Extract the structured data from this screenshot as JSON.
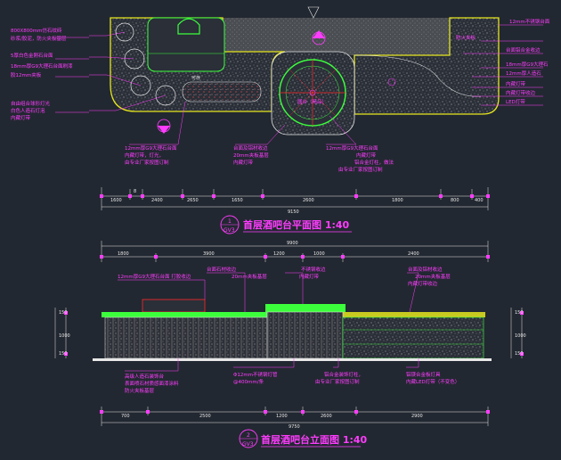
{
  "plan": {
    "title": "首层酒吧台平面图 1:40",
    "mark_num": "1",
    "mark_sheet": "GV3",
    "dims_top": [
      "1600",
      "8",
      "2400",
      "2650",
      "1650",
      "2600",
      "1800",
      "800",
      "400"
    ],
    "dim_total": "9150",
    "labels": {
      "ul1": "800X800mm仿石纹砖",
      "ul2": "砂浆/胶泥，防火夹板基层",
      "ul3": "5厚白色金刚石台面",
      "ul4": "18mm厚G9大理石台面刷漆",
      "ul5": "胶12mm夹板",
      "ul6": "自由组合球形灯光",
      "ul7": "白色人造石灯泡",
      "ul8": "内藏灯带",
      "counter": "可存",
      "center_title": "圆台（精品）",
      "bl1": "12mm厚G9大理石台面",
      "bl2": "内藏灯带，灯光，",
      "bl3": "由专业厂家按图订制",
      "bm1": "台面及铝材收边",
      "bm2": "20mm夹板基层",
      "bm3": "内藏灯带",
      "bc1": "12mm厚G9大理石台面",
      "bc2": "内藏灯带",
      "bc3": "铝合金灯柱，做法",
      "bc4": "由专业厂家按图订制",
      "r1": "12mm不锈钢台面",
      "r2": "防火夹板",
      "r3": "台面铝合金收边",
      "r4": "18mm厚G9大理石",
      "r5": "12mm厚人造石",
      "r6": "内藏灯带",
      "r7": "内藏灯带收边",
      "r8": "LED灯带"
    }
  },
  "elevation": {
    "title": "首层酒吧台立面图 1:40",
    "mark_num": "2",
    "mark_sheet": "GV3",
    "dims_top": [
      "1800",
      "3900",
      "1200",
      "1000",
      "2400"
    ],
    "dim_top_total": "9900",
    "dims_bottom": [
      "700",
      "2500",
      "1200",
      "2600",
      "2900"
    ],
    "dim_bottom_total": "9750",
    "side_left": [
      "150",
      "1000",
      "150"
    ],
    "side_right": [
      "150",
      "1000",
      "150"
    ],
    "labels": {
      "t1": "12mm厚G9大理石台面 打胶收边",
      "t2": "台面石材收边",
      "t3": "20mm夹板基层",
      "t4": "不锈钢收边",
      "t5": "内藏灯带",
      "t6": "台面及铝材收边",
      "t7": "20mm夹板基层",
      "t8": "内藏灯带收边",
      "b1": "高级人造石装饰台",
      "b2": "表面喷石材质感面漆涂料",
      "b3": "防火夹板基层",
      "b4": "Φ12mm不锈钢灯管",
      "b5": "@400mm/条",
      "b6": "铝合金装饰灯柱，",
      "b7": "由专业厂家按图订制",
      "b8": "铝镁合金板灯具",
      "b9": "内藏LED灯带（不变色）"
    }
  },
  "colors": {
    "background": "#222831",
    "magenta": "#ff3cff",
    "yellow": "#e6e61e",
    "green": "#3cff3c",
    "red": "#ff2828",
    "cyan": "#8ff6ff",
    "white": "#e8e8e8"
  }
}
